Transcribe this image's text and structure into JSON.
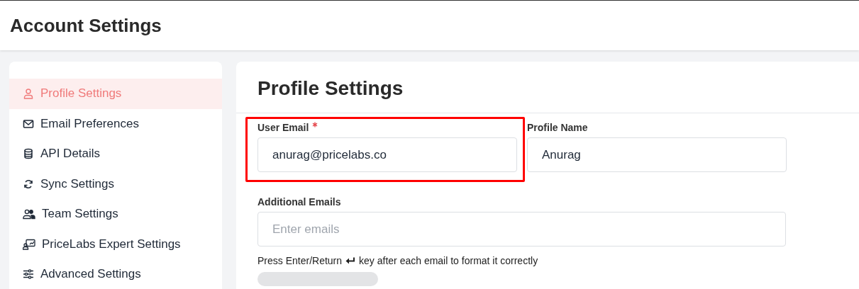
{
  "header": {
    "title": "Account Settings"
  },
  "sidebar": {
    "items": [
      {
        "label": "Profile Settings",
        "kind": "profile",
        "selected": true
      },
      {
        "label": "Email Preferences",
        "kind": "email",
        "selected": false
      },
      {
        "label": "API Details",
        "kind": "api",
        "selected": false
      },
      {
        "label": "Sync Settings",
        "kind": "sync",
        "selected": false
      },
      {
        "label": "Team Settings",
        "kind": "team",
        "selected": false
      },
      {
        "label": "PriceLabs Expert Settings",
        "kind": "expert",
        "selected": false
      },
      {
        "label": "Advanced Settings",
        "kind": "advanced",
        "selected": false
      }
    ]
  },
  "main": {
    "title": "Profile Settings",
    "fields": [
      {
        "label": "User Email",
        "required": true,
        "value": "anurag@pricelabs.co",
        "highlighted": true
      },
      {
        "label": "Profile Name",
        "value": "Anurag"
      }
    ],
    "additional": {
      "label": "Additional Emails",
      "placeholder": "Enter emails",
      "hint_before": "Press Enter/Return",
      "hint_after": "key after each email to format it correctly"
    }
  }
}
